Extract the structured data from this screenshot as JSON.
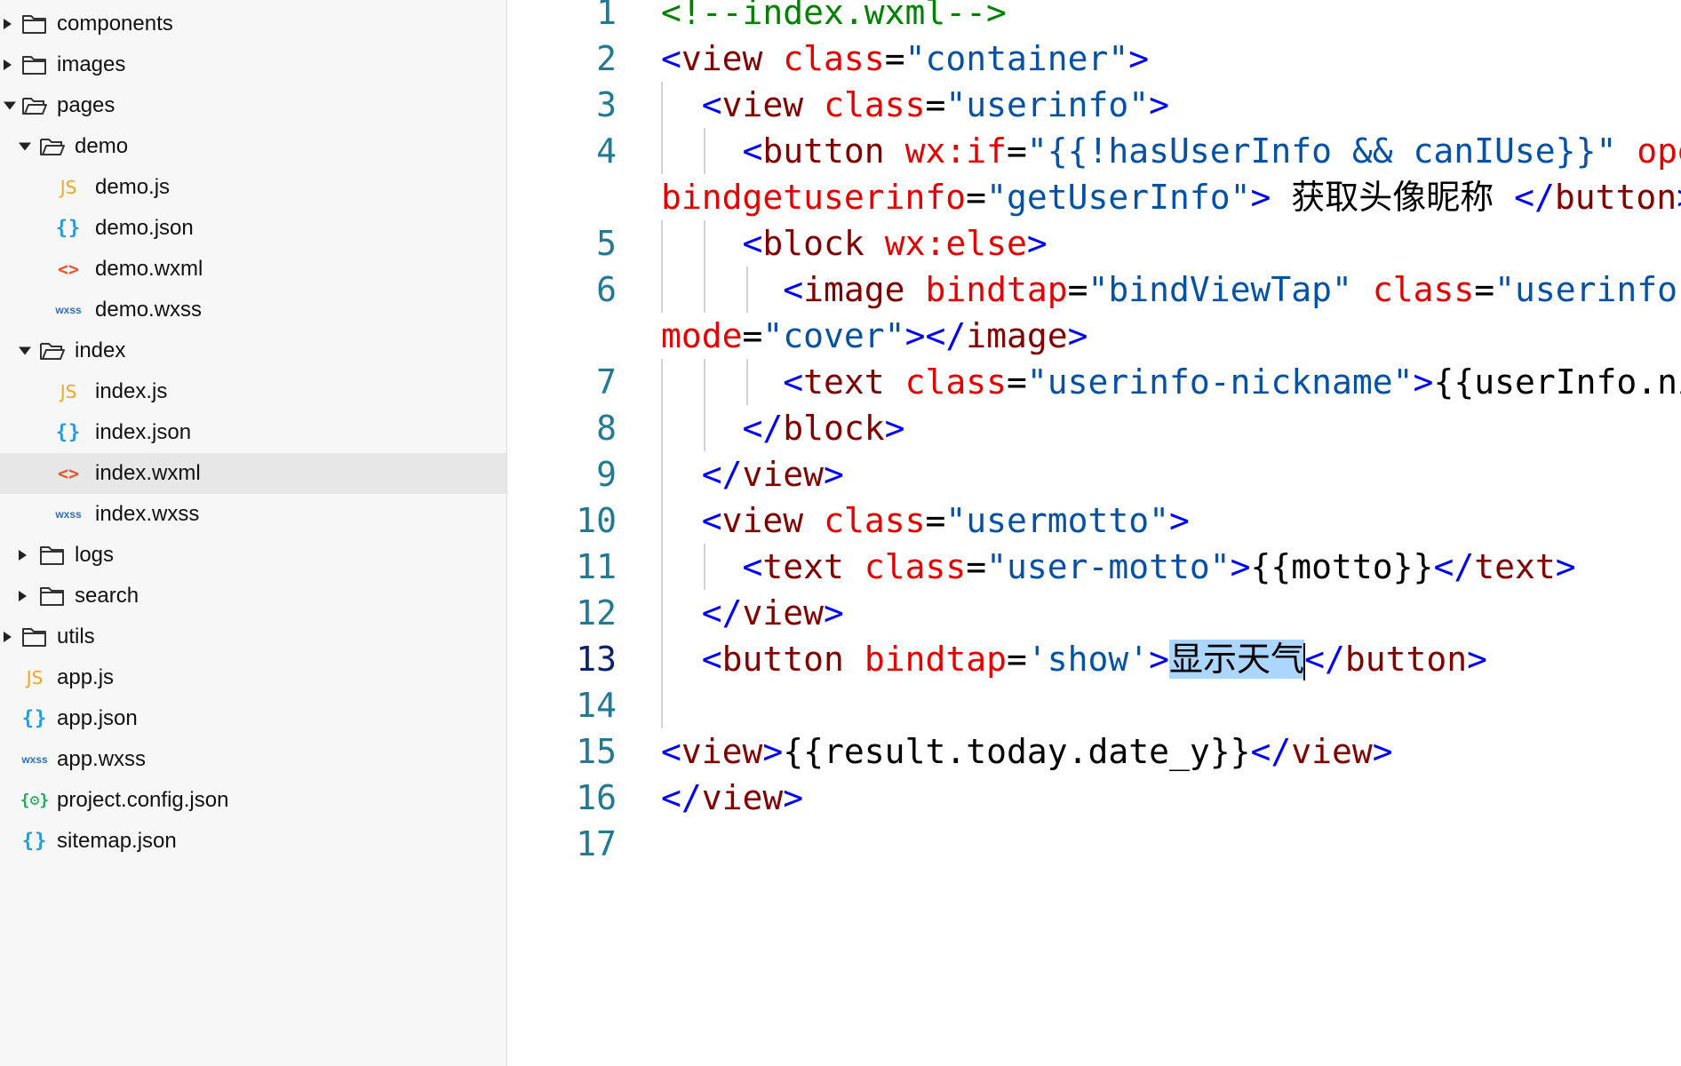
{
  "sidebar": {
    "items": [
      {
        "label": "components",
        "type": "folder",
        "depth": 0,
        "arrow": "right",
        "icon": "folder-icon"
      },
      {
        "label": "images",
        "type": "folder",
        "depth": 0,
        "arrow": "right",
        "icon": "folder-icon"
      },
      {
        "label": "pages",
        "type": "folder",
        "depth": 0,
        "arrow": "down",
        "icon": "folder-open-icon"
      },
      {
        "label": "demo",
        "type": "folder",
        "depth": 1,
        "arrow": "down",
        "icon": "folder-open-icon"
      },
      {
        "label": "demo.js",
        "type": "js",
        "depth": 2,
        "icon": "js-file-icon",
        "icon_text": "JS"
      },
      {
        "label": "demo.json",
        "type": "json",
        "depth": 2,
        "icon": "json-file-icon",
        "icon_text": "{}"
      },
      {
        "label": "demo.wxml",
        "type": "wxml",
        "depth": 2,
        "icon": "wxml-file-icon",
        "icon_text": "<>"
      },
      {
        "label": "demo.wxss",
        "type": "wxss",
        "depth": 2,
        "icon": "wxss-file-icon",
        "icon_text": "wxss"
      },
      {
        "label": "index",
        "type": "folder",
        "depth": 1,
        "arrow": "down",
        "icon": "folder-open-icon"
      },
      {
        "label": "index.js",
        "type": "js",
        "depth": 2,
        "icon": "js-file-icon",
        "icon_text": "JS"
      },
      {
        "label": "index.json",
        "type": "json",
        "depth": 2,
        "icon": "json-file-icon",
        "icon_text": "{}"
      },
      {
        "label": "index.wxml",
        "type": "wxml",
        "depth": 2,
        "icon": "wxml-file-icon",
        "icon_text": "<>",
        "selected": true
      },
      {
        "label": "index.wxss",
        "type": "wxss",
        "depth": 2,
        "icon": "wxss-file-icon",
        "icon_text": "wxss"
      },
      {
        "label": "logs",
        "type": "folder",
        "depth": 1,
        "arrow": "right",
        "icon": "folder-icon"
      },
      {
        "label": "search",
        "type": "folder",
        "depth": 1,
        "arrow": "right",
        "icon": "folder-icon"
      },
      {
        "label": "utils",
        "type": "folder",
        "depth": 0,
        "arrow": "right",
        "icon": "folder-icon"
      },
      {
        "label": "app.js",
        "type": "js",
        "depth": 0,
        "icon": "js-file-icon",
        "icon_text": "JS"
      },
      {
        "label": "app.json",
        "type": "json",
        "depth": 0,
        "icon": "json-file-icon",
        "icon_text": "{}"
      },
      {
        "label": "app.wxss",
        "type": "wxss",
        "depth": 0,
        "icon": "wxss-file-icon",
        "icon_text": "wxss"
      },
      {
        "label": "project.config.json",
        "type": "config",
        "depth": 0,
        "icon": "config-file-icon",
        "icon_text": "{⚙}"
      },
      {
        "label": "sitemap.json",
        "type": "json",
        "depth": 0,
        "icon": "json-file-icon",
        "icon_text": "{}"
      }
    ]
  },
  "editor": {
    "active_line": "13",
    "lines": [
      {
        "num": "1",
        "guides": 0,
        "tokens": [
          [
            "cmt",
            "<!--index.wxml-->"
          ]
        ]
      },
      {
        "num": "2",
        "guides": 0,
        "tokens": [
          [
            "tag",
            "<"
          ],
          [
            "tname",
            "view"
          ],
          [
            "txt",
            " "
          ],
          [
            "attr",
            "class"
          ],
          [
            "txt",
            "="
          ],
          [
            "str",
            "\"container\""
          ],
          [
            "tag",
            ">"
          ]
        ]
      },
      {
        "num": "3",
        "guides": 1,
        "tokens": [
          [
            "txt",
            "  "
          ],
          [
            "tag",
            "<"
          ],
          [
            "tname",
            "view"
          ],
          [
            "txt",
            " "
          ],
          [
            "attr",
            "class"
          ],
          [
            "txt",
            "="
          ],
          [
            "str",
            "\"userinfo\""
          ],
          [
            "tag",
            ">"
          ]
        ]
      },
      {
        "num": "4",
        "guides": 2,
        "tokens": [
          [
            "txt",
            "    "
          ],
          [
            "tag",
            "<"
          ],
          [
            "tname",
            "button"
          ],
          [
            "txt",
            " "
          ],
          [
            "attr",
            "wx:if"
          ],
          [
            "txt",
            "="
          ],
          [
            "str",
            "\"{{!hasUserInfo && canIUse}}\""
          ],
          [
            "txt",
            " "
          ],
          [
            "attr",
            "open-type"
          ],
          [
            "txt",
            "="
          ],
          [
            "str",
            "\"getUserInfo\""
          ]
        ]
      },
      {
        "num": "",
        "guides": 0,
        "tokens": [
          [
            "attr",
            "bindgetuserinfo"
          ],
          [
            "txt",
            "="
          ],
          [
            "str",
            "\"getUserInfo\""
          ],
          [
            "tag",
            ">"
          ],
          [
            "txt",
            " 获取头像昵称 "
          ],
          [
            "tag",
            "</"
          ],
          [
            "tname",
            "button"
          ],
          [
            "tag",
            ">"
          ]
        ]
      },
      {
        "num": "5",
        "guides": 2,
        "tokens": [
          [
            "txt",
            "    "
          ],
          [
            "tag",
            "<"
          ],
          [
            "tname",
            "block"
          ],
          [
            "txt",
            " "
          ],
          [
            "attr",
            "wx:else"
          ],
          [
            "tag",
            ">"
          ]
        ]
      },
      {
        "num": "6",
        "guides": 3,
        "tokens": [
          [
            "txt",
            "      "
          ],
          [
            "tag",
            "<"
          ],
          [
            "tname",
            "image"
          ],
          [
            "txt",
            " "
          ],
          [
            "attr",
            "bindtap"
          ],
          [
            "txt",
            "="
          ],
          [
            "str",
            "\"bindViewTap\""
          ],
          [
            "txt",
            " "
          ],
          [
            "attr",
            "class"
          ],
          [
            "txt",
            "="
          ],
          [
            "str",
            "\"userinfo-avatar\""
          ],
          [
            "txt",
            " "
          ],
          [
            "attr",
            "src"
          ],
          [
            "txt",
            "="
          ],
          [
            "str",
            "\"{{userInfo.avatarUrl}}\""
          ]
        ]
      },
      {
        "num": "",
        "guides": 0,
        "tokens": [
          [
            "attr",
            "mode"
          ],
          [
            "txt",
            "="
          ],
          [
            "str",
            "\"cover\""
          ],
          [
            "tag",
            "></"
          ],
          [
            "tname",
            "image"
          ],
          [
            "tag",
            ">"
          ]
        ]
      },
      {
        "num": "7",
        "guides": 3,
        "tokens": [
          [
            "txt",
            "      "
          ],
          [
            "tag",
            "<"
          ],
          [
            "tname",
            "text"
          ],
          [
            "txt",
            " "
          ],
          [
            "attr",
            "class"
          ],
          [
            "txt",
            "="
          ],
          [
            "str",
            "\"userinfo-nickname\""
          ],
          [
            "tag",
            ">"
          ],
          [
            "txt",
            "{{userInfo.nickName}}"
          ],
          [
            "tag",
            "</"
          ],
          [
            "tname",
            "text"
          ],
          [
            "tag",
            ">"
          ]
        ]
      },
      {
        "num": "8",
        "guides": 2,
        "tokens": [
          [
            "txt",
            "    "
          ],
          [
            "tag",
            "</"
          ],
          [
            "tname",
            "block"
          ],
          [
            "tag",
            ">"
          ]
        ]
      },
      {
        "num": "9",
        "guides": 1,
        "tokens": [
          [
            "txt",
            "  "
          ],
          [
            "tag",
            "</"
          ],
          [
            "tname",
            "view"
          ],
          [
            "tag",
            ">"
          ]
        ]
      },
      {
        "num": "10",
        "guides": 1,
        "tokens": [
          [
            "txt",
            "  "
          ],
          [
            "tag",
            "<"
          ],
          [
            "tname",
            "view"
          ],
          [
            "txt",
            " "
          ],
          [
            "attr",
            "class"
          ],
          [
            "txt",
            "="
          ],
          [
            "str",
            "\"usermotto\""
          ],
          [
            "tag",
            ">"
          ]
        ]
      },
      {
        "num": "11",
        "guides": 2,
        "tokens": [
          [
            "txt",
            "    "
          ],
          [
            "tag",
            "<"
          ],
          [
            "tname",
            "text"
          ],
          [
            "txt",
            " "
          ],
          [
            "attr",
            "class"
          ],
          [
            "txt",
            "="
          ],
          [
            "str",
            "\"user-motto\""
          ],
          [
            "tag",
            ">"
          ],
          [
            "txt",
            "{{motto}}"
          ],
          [
            "tag",
            "</"
          ],
          [
            "tname",
            "text"
          ],
          [
            "tag",
            ">"
          ]
        ]
      },
      {
        "num": "12",
        "guides": 1,
        "tokens": [
          [
            "txt",
            "  "
          ],
          [
            "tag",
            "</"
          ],
          [
            "tname",
            "view"
          ],
          [
            "tag",
            ">"
          ]
        ]
      },
      {
        "num": "13",
        "guides": 1,
        "tokens": [
          [
            "txt",
            "  "
          ],
          [
            "tag",
            "<"
          ],
          [
            "tname",
            "button"
          ],
          [
            "txt",
            " "
          ],
          [
            "attr",
            "bindtap"
          ],
          [
            "txt",
            "="
          ],
          [
            "str",
            "'show'"
          ],
          [
            "tag",
            ">"
          ],
          [
            "sel",
            "显示天气"
          ],
          [
            "caret",
            ""
          ],
          [
            "tag",
            "</"
          ],
          [
            "tname",
            "button"
          ],
          [
            "tag",
            ">"
          ]
        ]
      },
      {
        "num": "14",
        "guides": 1,
        "tokens": []
      },
      {
        "num": "15",
        "guides": 0,
        "tokens": [
          [
            "tag",
            "<"
          ],
          [
            "tname",
            "view"
          ],
          [
            "tag",
            ">"
          ],
          [
            "txt",
            "{{result.today.date_y}}"
          ],
          [
            "tag",
            "</"
          ],
          [
            "tname",
            "view"
          ],
          [
            "tag",
            ">"
          ]
        ]
      },
      {
        "num": "16",
        "guides": 0,
        "tokens": [
          [
            "tag",
            "</"
          ],
          [
            "tname",
            "view"
          ],
          [
            "tag",
            ">"
          ]
        ]
      },
      {
        "num": "17",
        "guides": 0,
        "tokens": []
      }
    ]
  }
}
